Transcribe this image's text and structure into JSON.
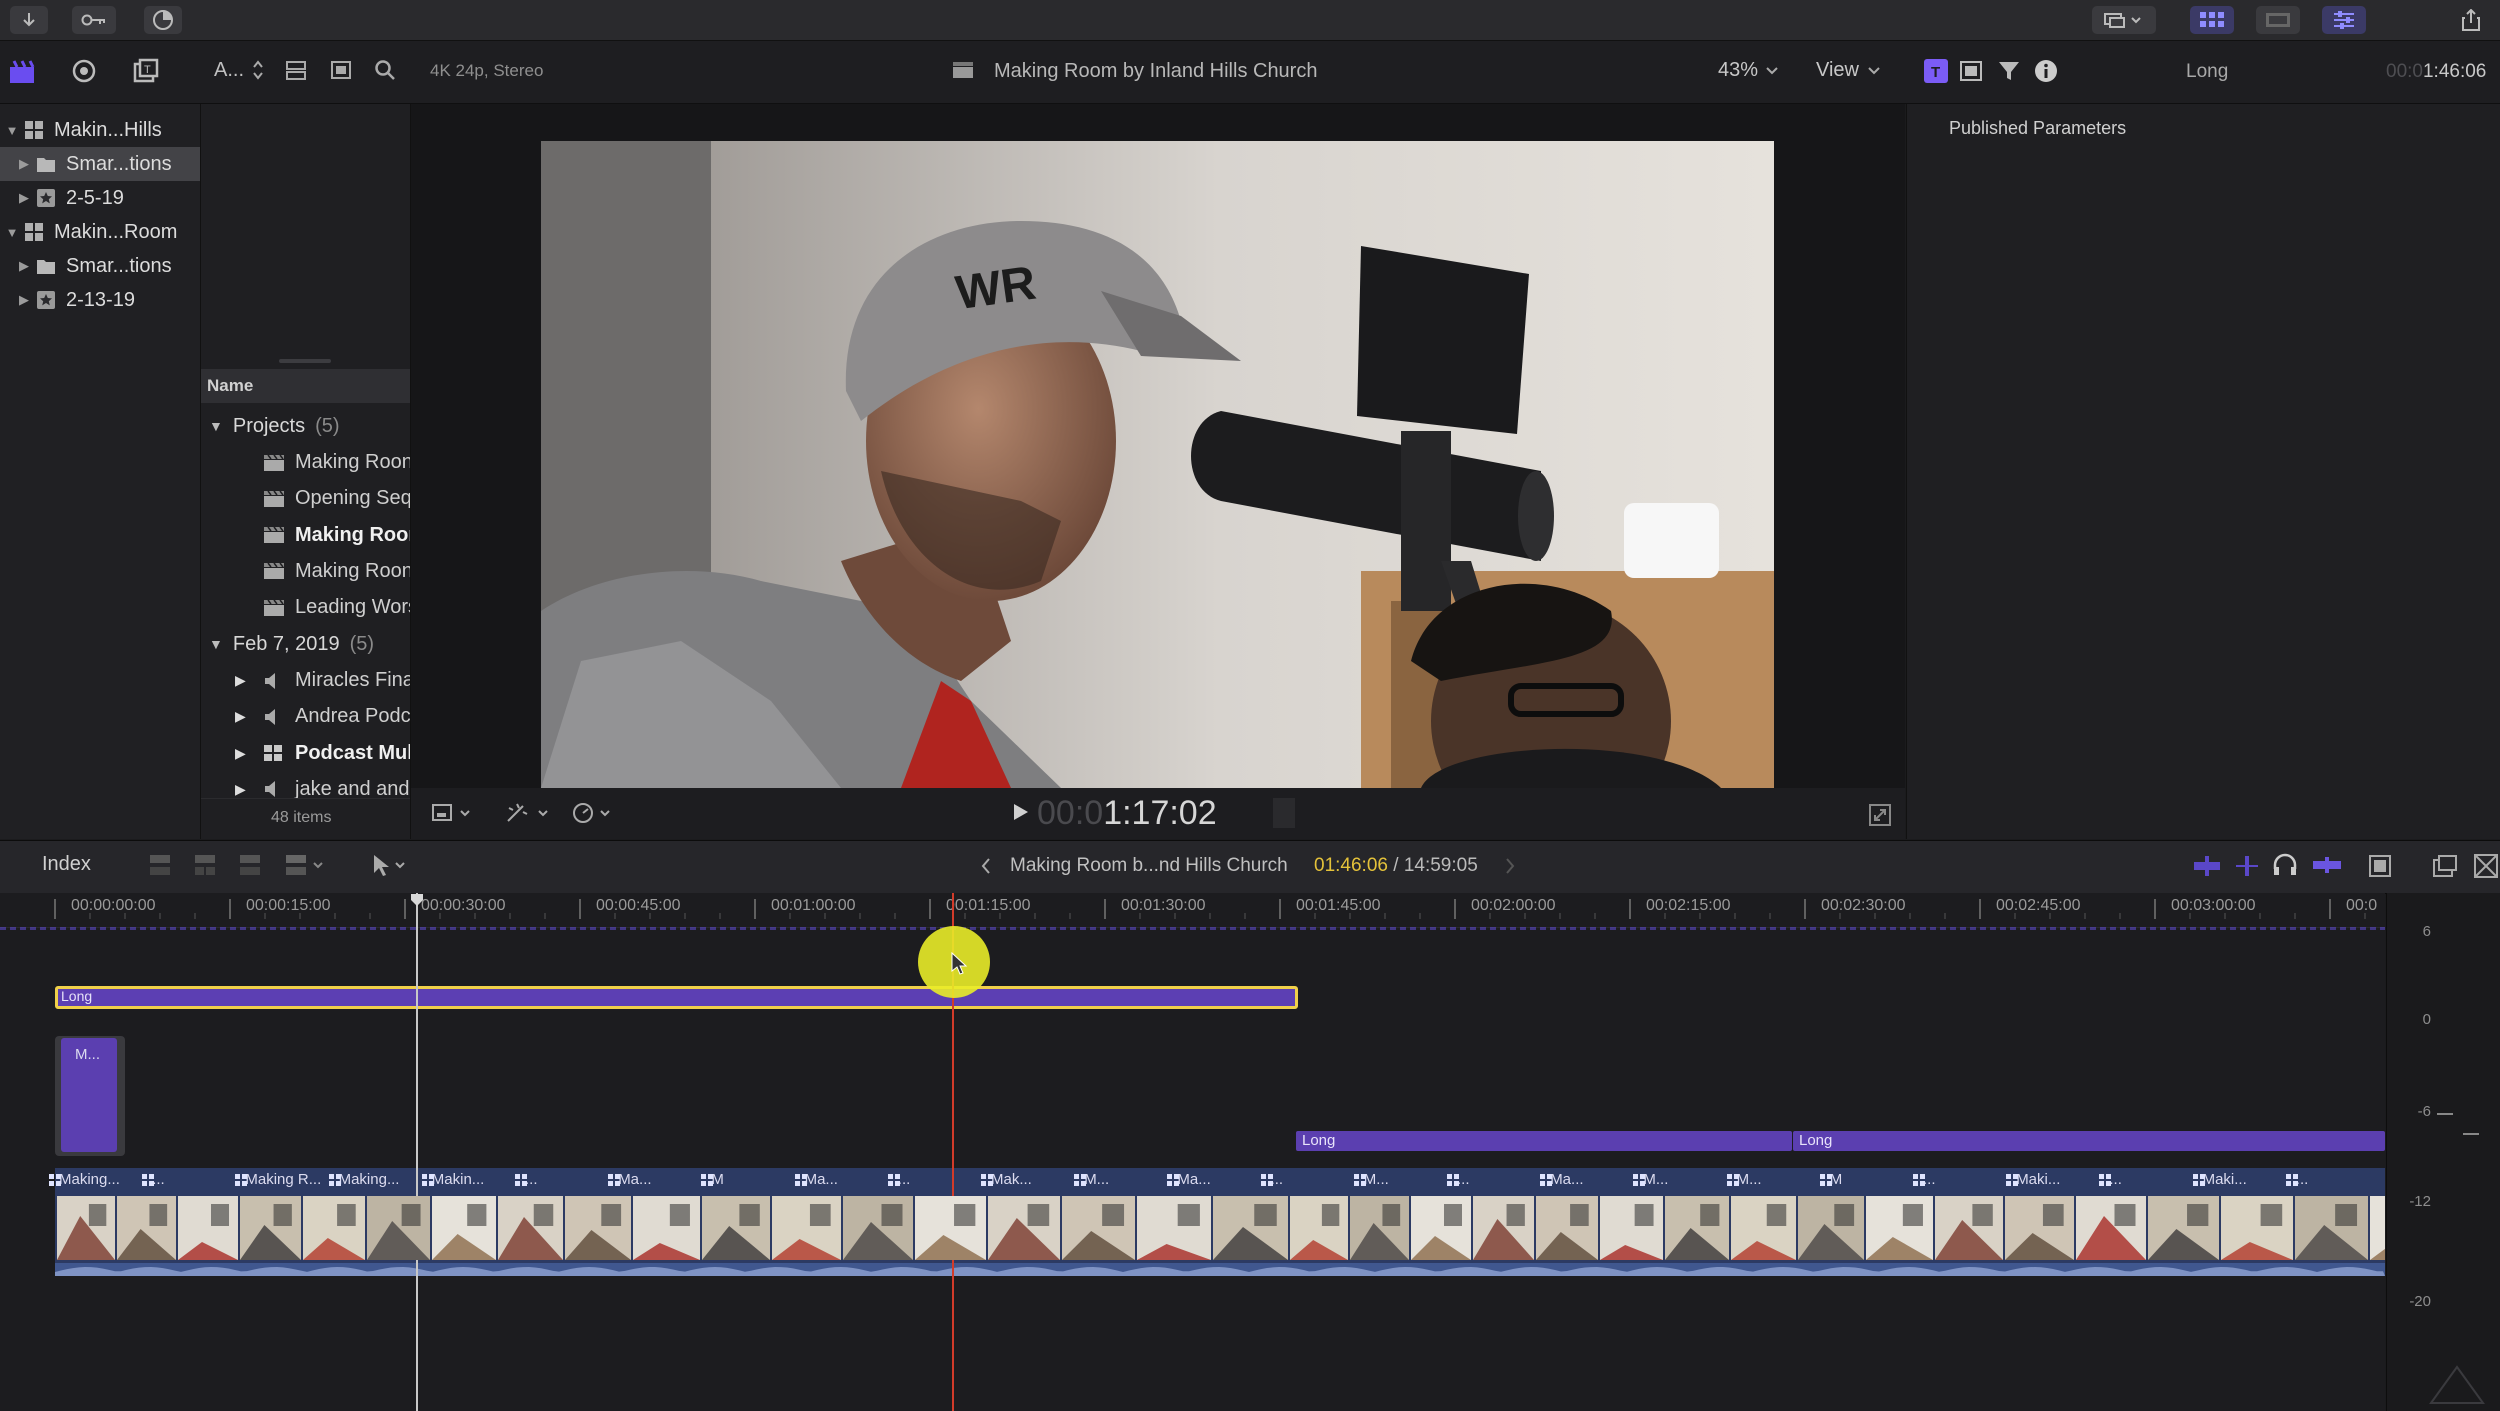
{
  "accent": "#7b5cf5",
  "toolbar": {
    "icons": [
      "import-icon",
      "key-icon",
      "progress-icon",
      "display-icon",
      "grid-icon",
      "filmstrip-icon",
      "sliders-icon",
      "share-icon"
    ]
  },
  "library_header": {
    "sort_label": "A...",
    "format": "4K 24p, Stereo"
  },
  "viewer": {
    "title": "Making Room by Inland Hills Church",
    "zoom": "43%",
    "view_label": "View",
    "timecode_dim": "00:0",
    "timecode": "1:17:02"
  },
  "inspector": {
    "title": "Long",
    "time_dim": "00:0",
    "time": "1:46:06",
    "heading": "Published Parameters"
  },
  "libraries": [
    {
      "label": "Makin...Hills",
      "level": 0,
      "expanded": true,
      "icon": "library-icon",
      "selected": false
    },
    {
      "label": "Smar...tions",
      "level": 1,
      "expanded": false,
      "icon": "folder-icon",
      "selected": true
    },
    {
      "label": "2-5-19",
      "level": 1,
      "expanded": false,
      "icon": "event-icon",
      "selected": false
    },
    {
      "label": "Makin...Room",
      "level": 0,
      "expanded": true,
      "icon": "library-icon",
      "selected": false
    },
    {
      "label": "Smar...tions",
      "level": 1,
      "expanded": false,
      "icon": "folder-icon",
      "selected": false
    },
    {
      "label": "2-13-19",
      "level": 1,
      "expanded": false,
      "icon": "event-icon",
      "selected": false
    }
  ],
  "browser": {
    "column_header": "Name",
    "groups": [
      {
        "label": "Projects",
        "count": "(5)",
        "items": [
          {
            "label": "Making Roon",
            "bold": false,
            "type": "project"
          },
          {
            "label": "Opening Seq",
            "bold": false,
            "type": "project"
          },
          {
            "label": "Making Roon",
            "bold": true,
            "type": "project"
          },
          {
            "label": "Making Roon",
            "bold": false,
            "type": "project"
          },
          {
            "label": "Leading Wors",
            "bold": false,
            "type": "project"
          }
        ]
      },
      {
        "label": "Feb 7, 2019",
        "count": "(5)",
        "items": [
          {
            "label": "Miracles Fina",
            "bold": false,
            "type": "audio"
          },
          {
            "label": "Andrea Podc",
            "bold": false,
            "type": "audio"
          },
          {
            "label": "Podcast Mult",
            "bold": true,
            "type": "multicam"
          },
          {
            "label": "jake and and",
            "bold": false,
            "type": "audio"
          }
        ]
      }
    ],
    "footer": "48 items"
  },
  "timeline_header": {
    "index_label": "Index",
    "project": "Making Room b...nd Hills Church",
    "position": "01:46:06",
    "separator": " / ",
    "duration": "14:59:05"
  },
  "ruler": [
    "00:00:00:00",
    "00:00:15:00",
    "00:00:30:00",
    "00:00:45:00",
    "00:01:00:00",
    "00:01:15:00",
    "00:01:30:00",
    "00:01:45:00",
    "00:02:00:00",
    "00:02:15:00",
    "00:02:30:00",
    "00:02:45:00",
    "00:03:00:00",
    "00:0"
  ],
  "timeline": {
    "storyline_label": "Long",
    "connected_clip_label": "M...",
    "title_clip_1": "Long",
    "title_clip_2": "Long",
    "primary_clip_labels": [
      "Making...",
      "...",
      "Making R...",
      "Making...",
      "Makin...",
      "...",
      "Ma...",
      "M",
      "Ma...",
      "...",
      "Mak...",
      "M...",
      "Ma...",
      "...",
      "M...",
      "...",
      "Ma...",
      "M...",
      "M...",
      "M",
      "...",
      "Maki...",
      "...",
      "Maki...",
      "..."
    ]
  },
  "meter": {
    "scale": [
      "6",
      "0",
      "-6",
      "-12",
      "-20"
    ]
  }
}
